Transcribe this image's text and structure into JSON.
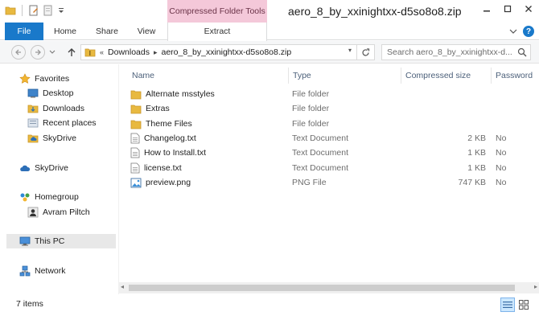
{
  "window": {
    "title": "aero_8_by_xxinightxx-d5so8o8.zip",
    "context_tab_group": "Compressed Folder Tools"
  },
  "ribbon": {
    "tabs": [
      "File",
      "Home",
      "Share",
      "View",
      "Extract"
    ]
  },
  "address": {
    "overflow": "«",
    "path": [
      "Downloads",
      "aero_8_by_xxinightxx-d5so8o8.zip"
    ],
    "search_placeholder": "Search aero_8_by_xxinightxx-d..."
  },
  "sidebar": {
    "favorites": {
      "label": "Favorites",
      "items": [
        "Desktop",
        "Downloads",
        "Recent places",
        "SkyDrive"
      ]
    },
    "skydrive": "SkyDrive",
    "homegroup": {
      "label": "Homegroup",
      "items": [
        "Avram Piltch"
      ]
    },
    "this_pc": "This PC",
    "network": "Network"
  },
  "columns": [
    "Name",
    "Type",
    "Compressed size",
    "Password"
  ],
  "files": [
    {
      "name": "Alternate msstyles",
      "type": "File folder",
      "size": "",
      "password": "",
      "icon": "folder-icon"
    },
    {
      "name": "Extras",
      "type": "File folder",
      "size": "",
      "password": "",
      "icon": "folder-icon"
    },
    {
      "name": "Theme Files",
      "type": "File folder",
      "size": "",
      "password": "",
      "icon": "folder-icon"
    },
    {
      "name": "Changelog.txt",
      "type": "Text Document",
      "size": "2 KB",
      "password": "No",
      "icon": "text-file-icon"
    },
    {
      "name": "How to Install.txt",
      "type": "Text Document",
      "size": "1 KB",
      "password": "No",
      "icon": "text-file-icon"
    },
    {
      "name": "license.txt",
      "type": "Text Document",
      "size": "1 KB",
      "password": "No",
      "icon": "text-file-icon"
    },
    {
      "name": "preview.png",
      "type": "PNG File",
      "size": "747 KB",
      "password": "No",
      "icon": "image-file-icon"
    }
  ],
  "status": {
    "item_count": "7 items"
  },
  "colors": {
    "file_tab": "#1979ca",
    "context_tab": "#f4c8d9",
    "folder": "#e8b940",
    "header_text": "#4c607a"
  }
}
